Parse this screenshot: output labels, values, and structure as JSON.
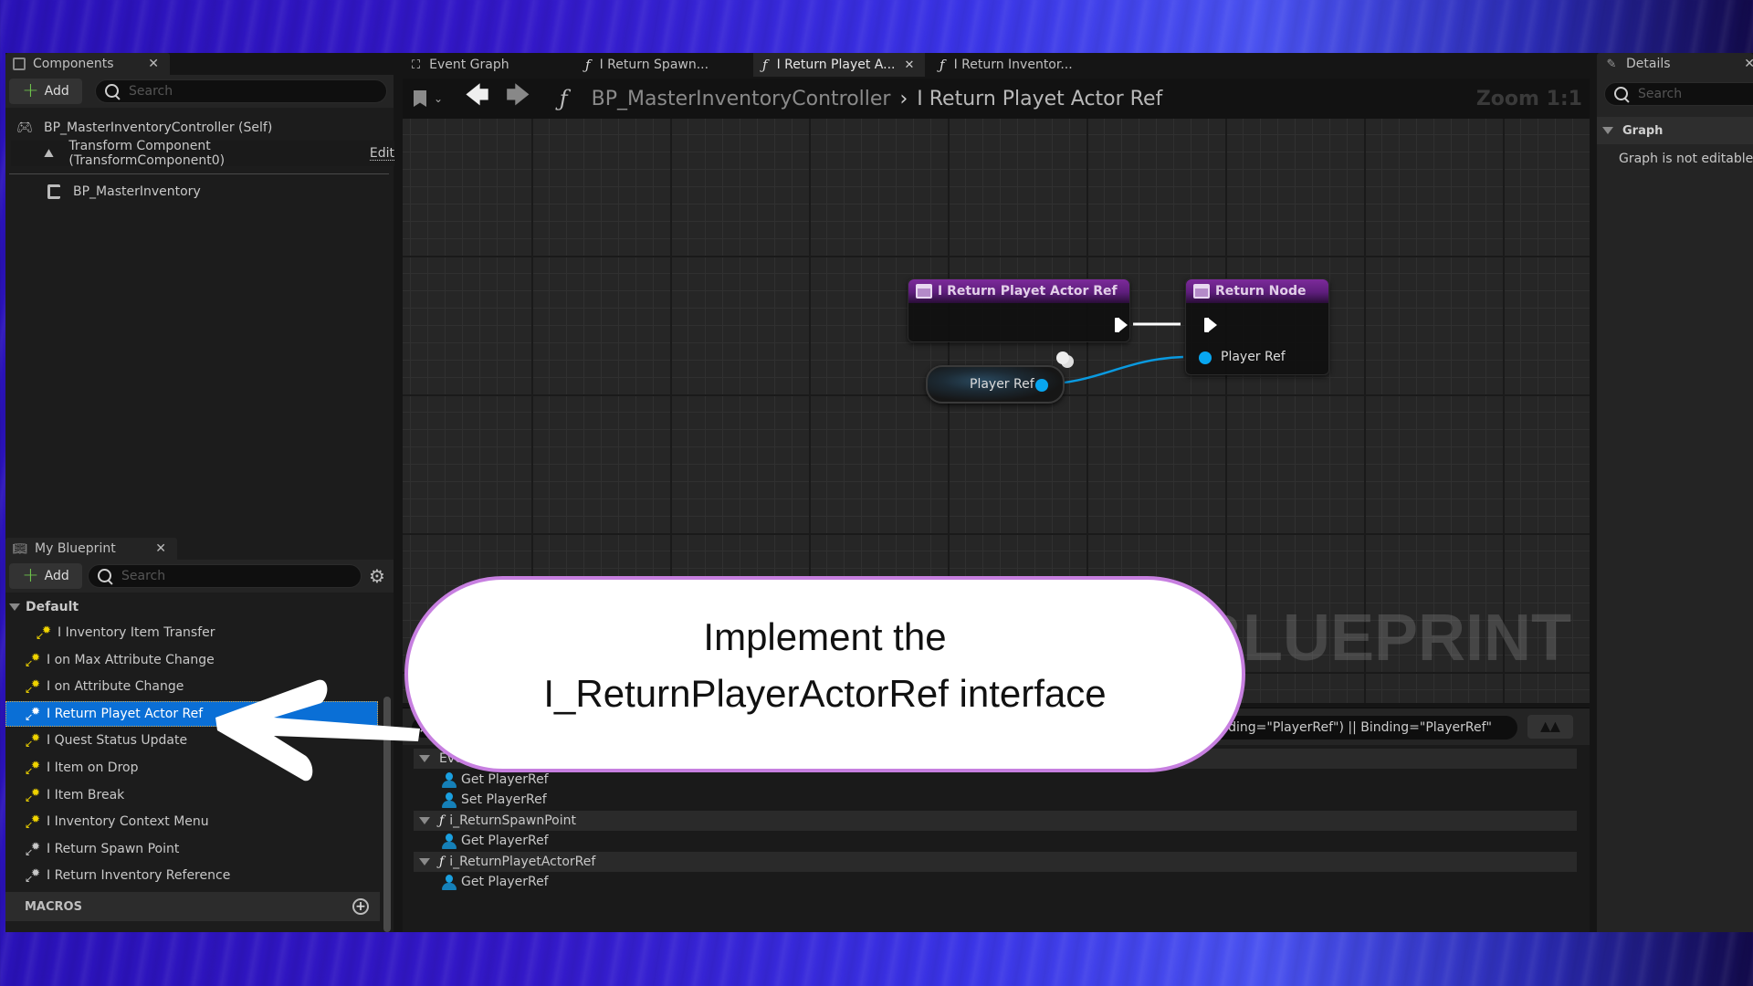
{
  "components_panel": {
    "tab_label": "Components",
    "add_label": "Add",
    "search_placeholder": "Search",
    "items": [
      {
        "label": "BP_MasterInventoryController (Self)",
        "icon": "gamepad-icon"
      },
      {
        "label": "Transform Component (TransformComponent0)",
        "icon": "transform-icon",
        "action": "Edit"
      },
      {
        "label": "BP_MasterInventory",
        "icon": "component-icon"
      }
    ]
  },
  "my_blueprint": {
    "tab_label": "My Blueprint",
    "add_label": "Add",
    "search_placeholder": "Search",
    "category": "Default",
    "items": [
      {
        "label": "I Inventory Item Transfer",
        "icon": "interface-function-icon",
        "color": "yellow"
      },
      {
        "label": "I on Max Attribute Change",
        "icon": "interface-function-icon",
        "color": "yellow"
      },
      {
        "label": "I on Attribute Change",
        "icon": "interface-function-icon",
        "color": "yellow"
      },
      {
        "label": "I Return Playet Actor Ref",
        "icon": "interface-function-icon",
        "color": "grey",
        "selected": true
      },
      {
        "label": "I Quest Status Update",
        "icon": "interface-function-icon",
        "color": "yellow"
      },
      {
        "label": "I Item on Drop",
        "icon": "interface-function-icon",
        "color": "yellow"
      },
      {
        "label": "I Item Break",
        "icon": "interface-function-icon",
        "color": "yellow"
      },
      {
        "label": "I Inventory Context Menu",
        "icon": "interface-function-icon",
        "color": "yellow"
      },
      {
        "label": "I Return Spawn Point",
        "icon": "interface-function-icon",
        "color": "grey"
      },
      {
        "label": "I Return Inventory Reference",
        "icon": "interface-function-icon",
        "color": "grey"
      }
    ],
    "macros_label": "MACROS"
  },
  "graph": {
    "tabs": [
      {
        "label": "Event Graph",
        "icon": "event-graph-icon",
        "active": false
      },
      {
        "label": "I Return Spawn...",
        "icon": "function-icon",
        "active": false
      },
      {
        "label": "I Return Playet A...",
        "icon": "function-icon",
        "active": true
      },
      {
        "label": "I Return Inventor...",
        "icon": "function-icon",
        "active": false
      }
    ],
    "breadcrumb": {
      "root": "BP_MasterInventoryController",
      "current": "I Return Playet Actor Ref"
    },
    "zoom": "Zoom 1:1",
    "watermark": "BLUEPRINT",
    "nodes": {
      "entry": {
        "title": "I Return Playet Actor Ref"
      },
      "return": {
        "title": "Return Node",
        "pin": "Player Ref"
      },
      "getter": {
        "label": "Player Ref"
      }
    }
  },
  "find_results": {
    "query": "s(Binding=\"PlayerRef\") || Binding=\"PlayerRef\"",
    "groups": [
      {
        "label": "EventGraph",
        "icon": "none",
        "items": [
          "Get PlayerRef",
          "Set PlayerRef"
        ]
      },
      {
        "label": "i_ReturnSpawnPoint",
        "icon": "function-icon",
        "items": [
          "Get PlayerRef"
        ]
      },
      {
        "label": "i_ReturnPlayetActorRef",
        "icon": "function-icon",
        "items": [
          "Get PlayerRef"
        ]
      }
    ]
  },
  "details_panel": {
    "tab_label": "Details",
    "search_placeholder": "Search",
    "section": "Graph",
    "message": "Graph is not editable."
  },
  "callout": {
    "line1": "Implement the",
    "line2": "I_ReturnPlayerActorRef interface",
    "border_color": "#c77fe0"
  },
  "colors": {
    "selection": "#0a6fd6",
    "node_header": "#7c2a9a",
    "object_pin": "#08a6f0",
    "add_plus": "#6dc24b",
    "interface_yellow": "#f0d400"
  }
}
